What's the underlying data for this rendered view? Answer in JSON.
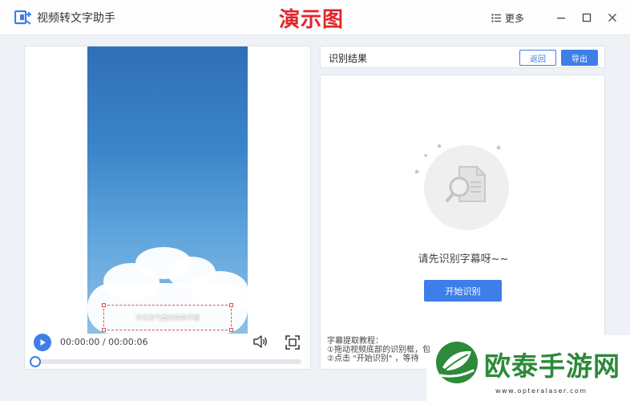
{
  "app": {
    "title": "视频转文字助手",
    "watermark": "演示图",
    "more_label": "更多"
  },
  "player": {
    "subtitle_text": "今天天气真的非常不错",
    "time": "00:00:00 / 00:00:06",
    "progress": 0.0
  },
  "result": {
    "title": "识别结果",
    "return_label": "返回",
    "export_label": "导出",
    "empty_text": "请先识别字幕呀~~",
    "start_label": "开始识别",
    "tutorial": [
      "字幕提取教程：",
      "①拖动视频底部的识别框，包",
      "②点击 \"开始识别\" ，等待"
    ]
  },
  "site_logo": {
    "brand": "欧泰手游网",
    "url": "www.opteralaser.com"
  },
  "colors": {
    "accent": "#3e7ee8",
    "watermark": "#e0262b",
    "brand_green": "#2d8a3a"
  }
}
